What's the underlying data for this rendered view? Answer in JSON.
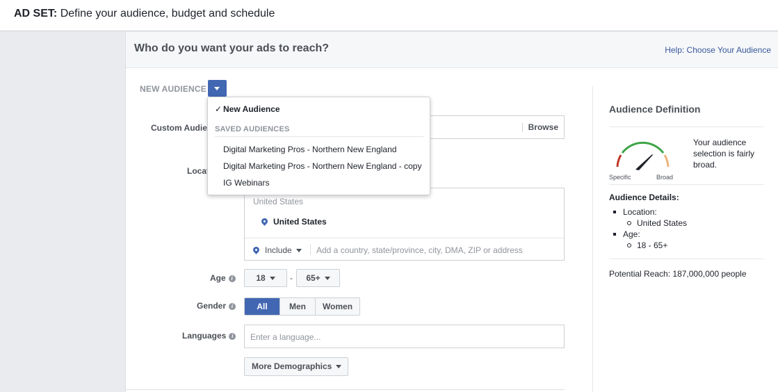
{
  "topbar": {
    "prefix": "AD SET:",
    "title": "Define your audience, budget and schedule"
  },
  "panel": {
    "title": "Who do you want your ads to reach?",
    "help_link": "Help: Choose Your Audience"
  },
  "audience": {
    "label": "NEW AUDIENCE",
    "dropdown": {
      "selected": "New Audience",
      "check": "✓",
      "section_label": "SAVED AUDIENCES",
      "items": [
        "Digital Marketing Pros - Northern New England",
        "Digital Marketing Pros - Northern New England - copy",
        "IG Webinars"
      ]
    }
  },
  "custom_audiences": {
    "label": "Custom Audie",
    "browse": "Browse"
  },
  "locations": {
    "label": "Locat",
    "group_header": "United States",
    "selected": "United States",
    "include_label": "Include",
    "search_placeholder": "Add a country, state/province, city, DMA, ZIP or address"
  },
  "age": {
    "label": "Age",
    "min": "18",
    "separator": "-",
    "max": "65+"
  },
  "gender": {
    "label": "Gender",
    "options": [
      "All",
      "Men",
      "Women"
    ],
    "selected": "All"
  },
  "languages": {
    "label": "Languages",
    "placeholder": "Enter a language..."
  },
  "more_demographics": {
    "label": "More Demographics"
  },
  "definition": {
    "title": "Audience Definition",
    "gauge_specific": "Specific",
    "gauge_broad": "Broad",
    "summary": "Your audience selection is fairly broad.",
    "details_title": "Audience Details:",
    "location_label": "Location:",
    "location_value": "United States",
    "age_label": "Age:",
    "age_value": "18 - 65+",
    "potential_reach": "Potential Reach: 187,000,000 people",
    "gauge_colors": {
      "left": "#c0392b",
      "middle": "#3ea447",
      "right": "#f0b27a",
      "needle": "#1d2129"
    }
  },
  "colors": {
    "accent": "#4267b2",
    "link": "#365899"
  }
}
